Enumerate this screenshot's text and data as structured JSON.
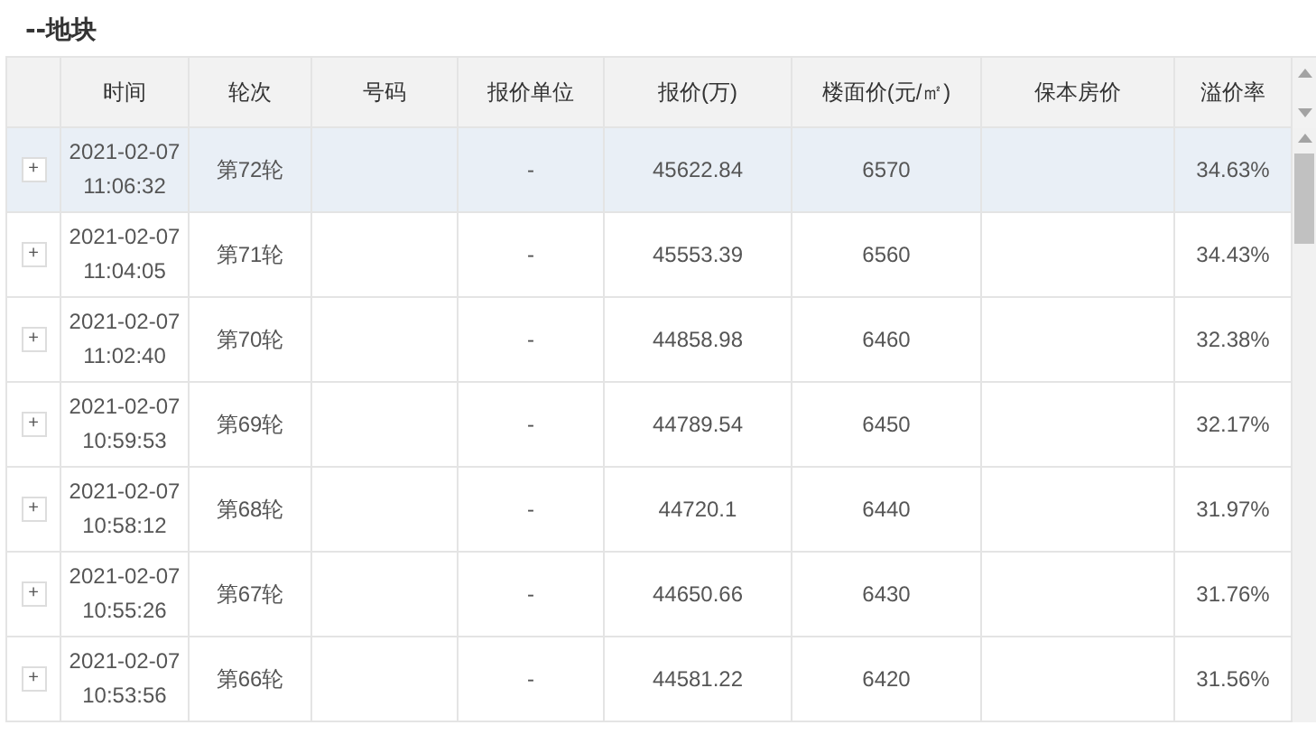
{
  "title": "--地块",
  "table": {
    "columns": [
      "时间",
      "轮次",
      "号码",
      "报价单位",
      "报价(万)",
      "楼面价(元/㎡)",
      "保本房价",
      "溢价率"
    ],
    "rows": [
      {
        "expand": "+",
        "date": "2021-02-07",
        "time": "11:06:32",
        "round": "第72轮",
        "number": "",
        "unit": "-",
        "price": "45622.84",
        "floor_price": "6570",
        "break_even": "",
        "premium": "34.63%",
        "selected": true
      },
      {
        "expand": "+",
        "date": "2021-02-07",
        "time": "11:04:05",
        "round": "第71轮",
        "number": "",
        "unit": "-",
        "price": "45553.39",
        "floor_price": "6560",
        "break_even": "",
        "premium": "34.43%",
        "selected": false
      },
      {
        "expand": "+",
        "date": "2021-02-07",
        "time": "11:02:40",
        "round": "第70轮",
        "number": "",
        "unit": "-",
        "price": "44858.98",
        "floor_price": "6460",
        "break_even": "",
        "premium": "32.38%",
        "selected": false
      },
      {
        "expand": "+",
        "date": "2021-02-07",
        "time": "10:59:53",
        "round": "第69轮",
        "number": "",
        "unit": "-",
        "price": "44789.54",
        "floor_price": "6450",
        "break_even": "",
        "premium": "32.17%",
        "selected": false
      },
      {
        "expand": "+",
        "date": "2021-02-07",
        "time": "10:58:12",
        "round": "第68轮",
        "number": "",
        "unit": "-",
        "price": "44720.1",
        "floor_price": "6440",
        "break_even": "",
        "premium": "31.97%",
        "selected": false
      },
      {
        "expand": "+",
        "date": "2021-02-07",
        "time": "10:55:26",
        "round": "第67轮",
        "number": "",
        "unit": "-",
        "price": "44650.66",
        "floor_price": "6430",
        "break_even": "",
        "premium": "31.76%",
        "selected": false
      },
      {
        "expand": "+",
        "date": "2021-02-07",
        "time": "10:53:56",
        "round": "第66轮",
        "number": "",
        "unit": "-",
        "price": "44581.22",
        "floor_price": "6420",
        "break_even": "",
        "premium": "31.56%",
        "selected": false
      }
    ]
  }
}
